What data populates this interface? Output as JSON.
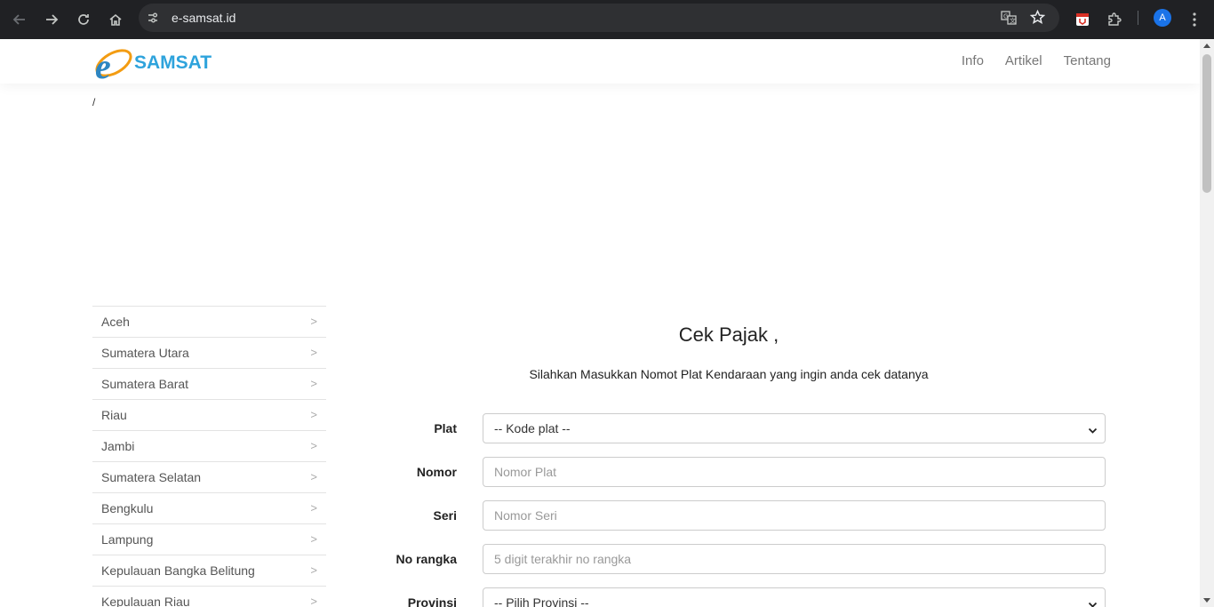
{
  "browser": {
    "url": "e-samsat.id",
    "profile_initial": "A"
  },
  "navbar": {
    "logo_text": "SAMSAT",
    "links": [
      "Info",
      "Artikel",
      "Tentang"
    ]
  },
  "breadcrumb": "/",
  "sidebar": {
    "items": [
      {
        "label": "Aceh",
        "chevron": ">"
      },
      {
        "label": "Sumatera Utara",
        "chevron": ">"
      },
      {
        "label": "Sumatera Barat",
        "chevron": ">"
      },
      {
        "label": "Riau",
        "chevron": ">"
      },
      {
        "label": "Jambi",
        "chevron": ">"
      },
      {
        "label": "Sumatera Selatan",
        "chevron": ">"
      },
      {
        "label": "Bengkulu",
        "chevron": ">"
      },
      {
        "label": "Lampung",
        "chevron": ">"
      },
      {
        "label": "Kepulauan Bangka Belitung",
        "chevron": ">"
      },
      {
        "label": "Kepulauan Riau",
        "chevron": ">"
      }
    ]
  },
  "form": {
    "title": "Cek Pajak ,",
    "subtitle": "Silahkan Masukkan Nomot Plat Kendaraan yang ingin anda cek datanya",
    "plat": {
      "label": "Plat",
      "value": "-- Kode plat --"
    },
    "nomor": {
      "label": "Nomor",
      "placeholder": "Nomor Plat"
    },
    "seri": {
      "label": "Seri",
      "placeholder": "Nomor Seri"
    },
    "rangka": {
      "label": "No rangka",
      "placeholder": "5 digit terakhir no rangka"
    },
    "provinsi": {
      "label": "Provinsi",
      "value": "-- Pilih Provinsi --"
    }
  },
  "colors": {
    "chrome_bg": "#202124",
    "logo_blue": "#2ea3dc",
    "logo_orange": "#f39c12",
    "nav_link": "#777777"
  }
}
